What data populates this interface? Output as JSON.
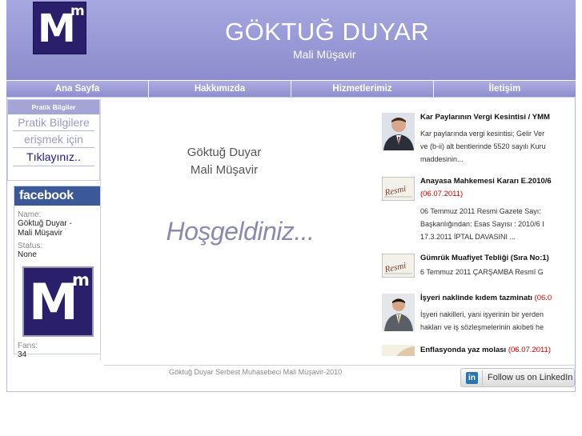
{
  "header": {
    "logo_big": "M",
    "logo_small": "m",
    "title": "GÖKTUĞ DUYAR",
    "subtitle": "Mali Müşavir"
  },
  "nav": [
    {
      "label": "Ana Sayfa"
    },
    {
      "label": "Hakkımızda"
    },
    {
      "label": "Hizmetlerimiz"
    },
    {
      "label": "İletişim"
    }
  ],
  "pratik": {
    "heading": "Pratik Bilgiler",
    "line1": "Pratik Bilgilere",
    "line2": "erişmek için",
    "link": "Tıklayınız.."
  },
  "facebook": {
    "heading": "facebook",
    "name_label": "Name:",
    "name_line1": "Göktuğ Duyar -",
    "name_line2": "Mali Müşavir",
    "status_label": "Status:",
    "status_value": "None",
    "fans_label": "Fans:",
    "fans_value": "34"
  },
  "center": {
    "name_line1": "Göktuğ Duyar",
    "name_line2": "Mali Müşavir",
    "welcome": "Hoşgeldiniz..."
  },
  "news": [
    {
      "title": "Kar Paylarının Vergi Kesintisi / YMM",
      "date": "",
      "body": [
        "Kar paylarında vergi kesintisi; Gelir Ver",
        "ve (b-ii) alt bentlerinde 5520 sayılı Kuru",
        "maddesinin..."
      ],
      "thumb": "person-photo"
    },
    {
      "title": "Anayasa Mahkemesi Kararı E.2010/6",
      "date": "(06.07.2011)",
      "body": [
        "06 Temmuz 2011 Resmi Gazete Sayı:",
        "Başkanlığından: Esas Sayısı : 2010/6 I",
        "17.3.2011 İPTAL DAVASINI ..."
      ],
      "thumb": "resmi-gazete"
    },
    {
      "title": "Gümrük Muafiyet Tebliği (Sıra No:1)",
      "date": "",
      "body": [
        "6 Temmuz 2011 ÇARŞAMBA Resmî G"
      ],
      "thumb": "resmi-gazete"
    },
    {
      "title": "İşyeri naklinde kıdem tazminatı",
      "date": "(06.0",
      "body": [
        "İşyeri nakilleri, yani işyerinin bir yerden",
        "hakları ve iş sözleşmelerinin akıbeti he"
      ],
      "thumb": "person-photo"
    },
    {
      "title": "Enflasyonda yaz molası",
      "date": "(06.07.2011)",
      "body": [],
      "thumb": "chart-thumb"
    }
  ],
  "footer": {
    "text": "Göktuğ Duyar Serbest Muhasebeci Mali Müşavir-2010",
    "linkedin_icon": "in",
    "linkedin_label": "Follow us on LinkedIn"
  }
}
